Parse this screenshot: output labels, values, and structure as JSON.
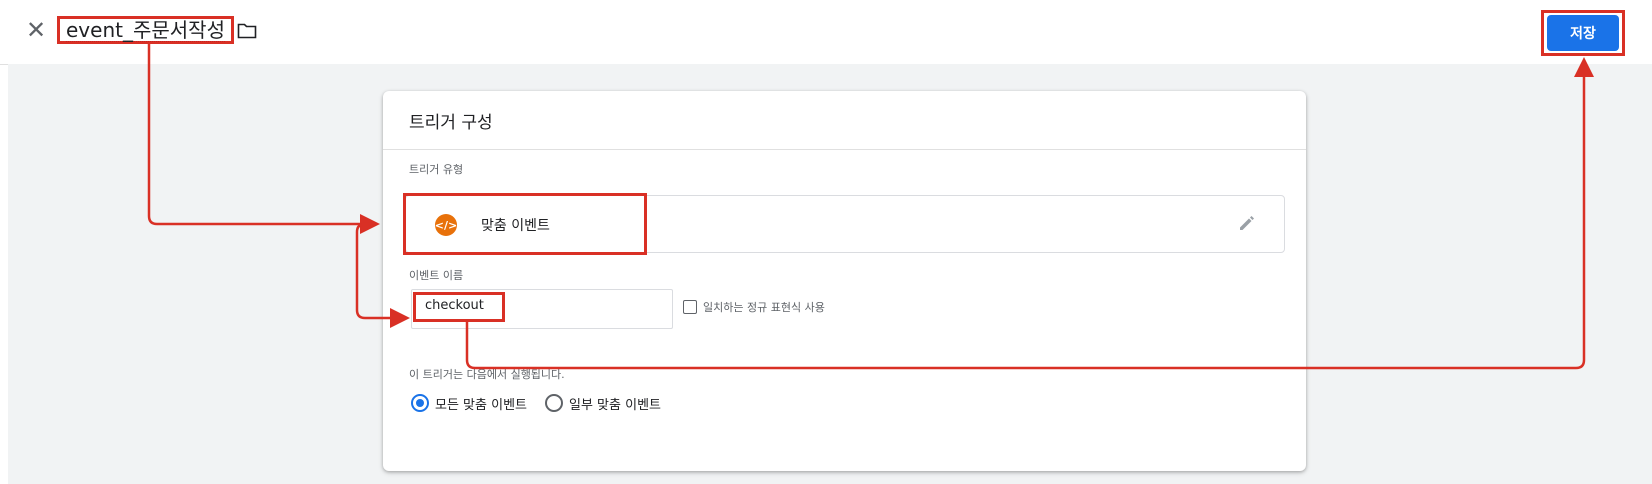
{
  "header": {
    "close_icon": "close-icon",
    "title": "event_주문서작성",
    "folder_icon": "folder-icon",
    "save_label": "저장"
  },
  "card": {
    "title": "트리거 구성",
    "trigger_type_label": "트리거 유형",
    "trigger_type_value": "맞춤 이벤트",
    "trigger_type_icon": "</>",
    "event_name_label": "이벤트 이름",
    "event_name_value": "checkout",
    "regex_checkbox_label": "일치하는 정규 표현식 사용",
    "fires_on_label": "이 트리거는 다음에서 실행됩니다.",
    "radio_all": "모든 맞춤 이벤트",
    "radio_some": "일부 맞춤 이벤트",
    "radio_selected": "all"
  },
  "colors": {
    "accent": "#1a73e8",
    "highlight": "#d93025",
    "trigger_icon": "#e8710a"
  }
}
